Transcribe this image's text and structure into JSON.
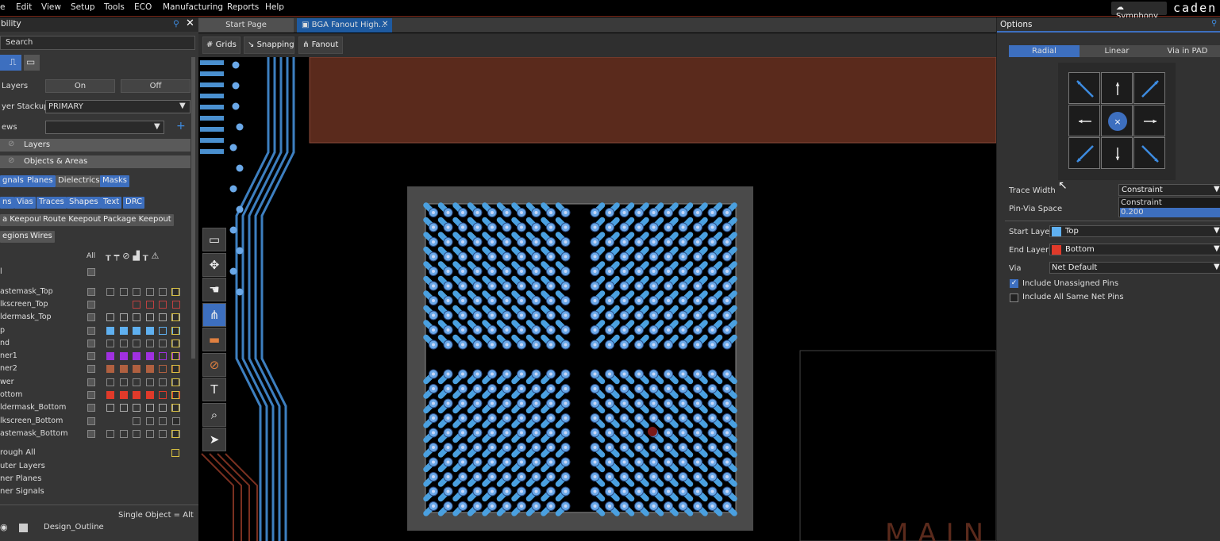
{
  "menu": [
    "Edit",
    "View",
    "Setup",
    "Tools",
    "ECO",
    "Manufacturing",
    "Reports",
    "Help"
  ],
  "symphony": "Symphony",
  "brand": "caden",
  "left_panel": {
    "title": "bility",
    "search_placeholder": "Search",
    "all_layers_label": "Layers",
    "on": "On",
    "off": "Off",
    "stackup_label": "yer Stackup",
    "stackup_value": "PRIMARY",
    "views_label": "ews",
    "sect_layers": "Layers",
    "sect_objects": "Objects & Areas",
    "chips1": [
      "gnals",
      "Planes",
      "Dielectrics",
      "Masks"
    ],
    "chips2": [
      "ns",
      "Vias",
      "Traces",
      "Shapes",
      "Text",
      "DRC"
    ],
    "chips3": [
      "a Keepout",
      "Route Keepout",
      "Package Keepout"
    ],
    "chips4": [
      "egions",
      "Wires"
    ],
    "all_col": "All",
    "rows": [
      "l",
      "astemask_Top",
      "lkscreen_Top",
      "ldermask_Top",
      "p",
      "nd",
      "ner1",
      "ner2",
      "wer",
      "ottom",
      "ldermask_Bottom",
      "lkscreen_Bottom",
      "astemask_Bottom"
    ],
    "groups": [
      "rough All",
      "uter Layers",
      "ner Planes",
      "ner Signals"
    ],
    "single_obj": "Single Object = Alt",
    "design_outline": "Design_Outline"
  },
  "tabs": [
    "Start Page",
    "BGA Fanout High..."
  ],
  "toolbar": [
    "Grids",
    "Snapping",
    "Fanout"
  ],
  "canvas": {
    "silk_text": "MAIN"
  },
  "options": {
    "title": "Options",
    "tabs": [
      "Radial",
      "Linear",
      "Via in PAD"
    ],
    "trace_width_label": "Trace Width",
    "trace_width_value": "Constraint",
    "dropdown_options": [
      "Constraint",
      "0.200"
    ],
    "pin_via_label": "Pin-Via Space",
    "start_layer_label": "Start Layer",
    "start_layer_value": "Top",
    "start_color": "#5fb0f0",
    "end_layer_label": "End Layer",
    "end_layer_value": "Bottom",
    "end_color": "#e03a2a",
    "via_label": "Via",
    "via_value": "Net Default",
    "check1": "Include Unassigned Pins",
    "check2": "Include All Same Net Pins"
  }
}
